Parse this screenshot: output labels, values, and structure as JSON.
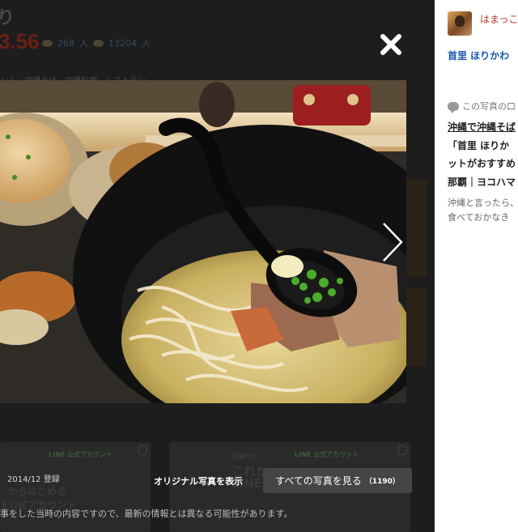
{
  "background_page": {
    "title_fragment": "り",
    "score_fragment": "3.56",
    "review_count": "268",
    "review_unit": "人",
    "save_count": "13204",
    "save_unit": "人",
    "genre_line": "ンル：沖縄そば、沖縄料理、レストラン",
    "card_tag_left": "LINE 公式アカウント",
    "card_tag_right": "LINE 公式アカウント",
    "card_left_line1": "からはじめる",
    "card_left_line2": "E公式アカウント",
    "card_right_line1": "これか",
    "card_right_line2": "LINE",
    "card_right_sub": "店舗向け"
  },
  "modal": {
    "close_icon": "close-icon",
    "next_icon": "chevron-right-icon",
    "photo_alt": "沖縄そば",
    "registered_date": "2014/12 登録",
    "original_photo_link": "オリジナル写真を表示",
    "all_photos_label": "すべての写真を見る",
    "all_photos_count": "（1190）",
    "notice": "事をした当時の内容ですので、最新の情報とは異なる可能性があります。"
  },
  "sidebar": {
    "user_name": "はまっこ",
    "location_link": "首里 ほりかわ",
    "section_heading": "この写真の口",
    "article_title_lines": [
      "沖縄で沖縄そば",
      "「首里 ほりか",
      "ットがおすすめ",
      "那覇｜ヨコハマ"
    ],
    "article_desc_lines": [
      "沖縄と言ったら、",
      "食べておかなき"
    ]
  },
  "colors": {
    "overlay": "#1c1c1c",
    "accent_red": "#c0392b",
    "link_blue": "#1a55b0",
    "button_bg": "#454545"
  }
}
